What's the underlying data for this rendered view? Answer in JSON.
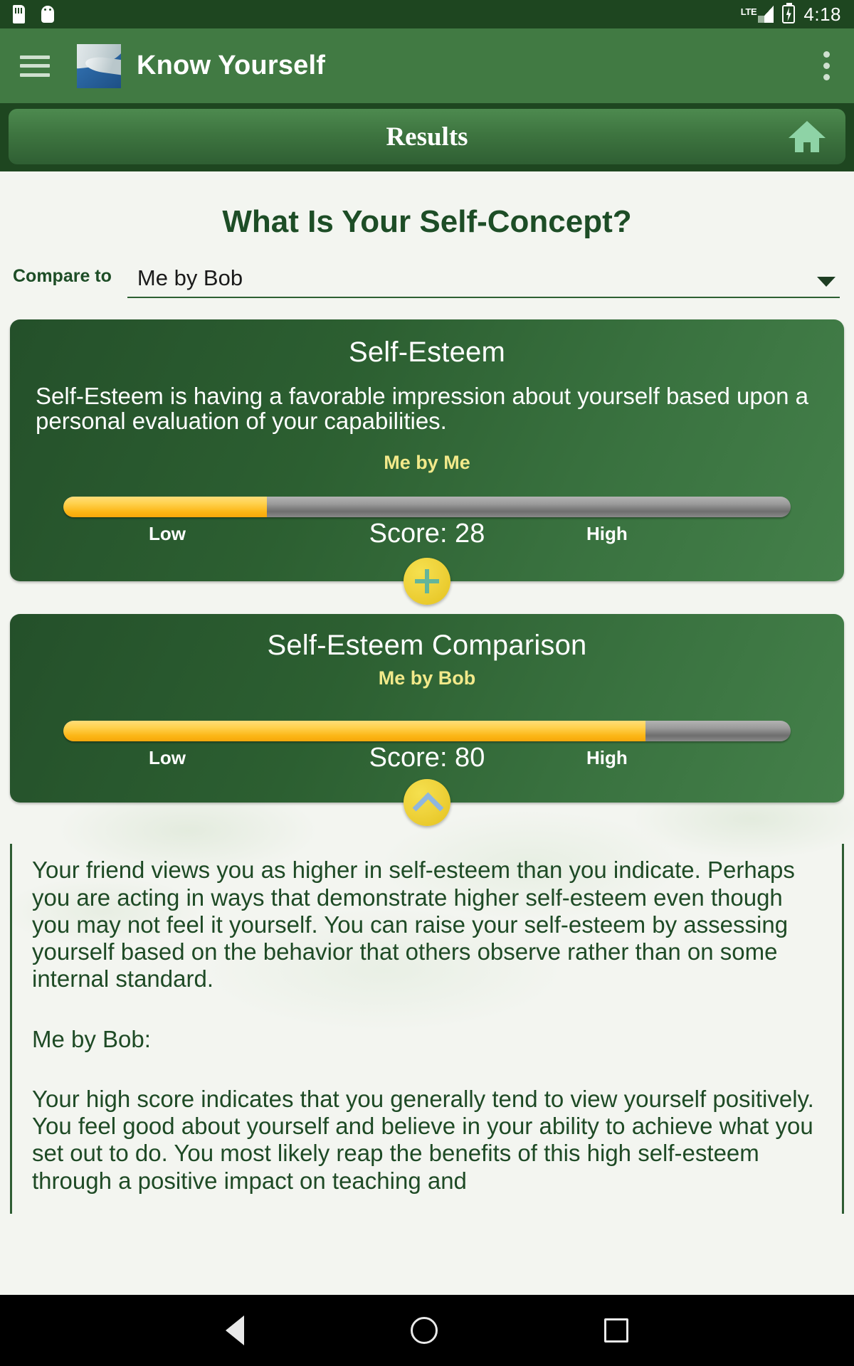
{
  "status_bar": {
    "icons": [
      "sd-card-icon",
      "android-icon"
    ],
    "network": "LTE",
    "battery": "charging",
    "time": "4:18"
  },
  "app_bar": {
    "menu_icon": "hamburger-menu-icon",
    "logo_icon": "app-logo-icon",
    "title": "Know Yourself",
    "overflow_icon": "overflow-menu-icon"
  },
  "results_bar": {
    "title": "Results",
    "home_icon": "home-icon"
  },
  "page": {
    "title": "What Is Your Self-Concept?"
  },
  "compare": {
    "label": "Compare to",
    "selected": "Me by Bob",
    "caret_icon": "chevron-down-icon"
  },
  "cards": [
    {
      "title": "Self-Esteem",
      "description": "Self-Esteem is having a favorable impression about yourself based upon a personal evaluation of your capabilities.",
      "sublabel": "Me by Me",
      "low_label": "Low",
      "high_label": "High",
      "score_label": "Score: 28",
      "score": 28,
      "fab_icon": "plus-icon"
    },
    {
      "title": "Self-Esteem  Comparison",
      "sublabel": "Me by Bob",
      "low_label": "Low",
      "high_label": "High",
      "score_label": "Score: 80",
      "score": 80,
      "fab_icon": "chevron-up-icon"
    }
  ],
  "article": {
    "paragraph_1": "Your friend views you as higher in self-esteem than you indicate. Perhaps you are acting in ways that demonstrate higher self-esteem even though you may not feel it yourself. You can raise your self-esteem by assessing yourself based on the behavior that others observe rather than on some internal standard.",
    "heading": "Me by Bob:",
    "paragraph_2": "Your high score indicates that you generally tend to view yourself positively. You feel good about yourself and believe in your ability to achieve what you set out to do. You most likely reap the benefits of this high self-esteem through a positive impact on teaching and"
  },
  "nav_bar": {
    "back_icon": "back-triangle-icon",
    "home_icon": "home-circle-icon",
    "recents_icon": "recents-square-icon"
  },
  "colors": {
    "dark_green": "#1e4620",
    "app_green": "#417a43",
    "card_green": "#2c5f31",
    "accent_yellow": "#fcb514",
    "sublabel_yellow": "#f2e98a",
    "text_green": "#1e4a25",
    "background": "#f3f5f0"
  },
  "chart_data": {
    "type": "bar",
    "title": "Self-Esteem score bars",
    "categories": [
      "Me by Me",
      "Me by Bob"
    ],
    "values": [
      28,
      80
    ],
    "xlabel": "",
    "ylabel": "Score",
    "ylim": [
      0,
      100
    ],
    "tick_labels": [
      "Low",
      "High"
    ],
    "grid": false,
    "legend": "none"
  }
}
